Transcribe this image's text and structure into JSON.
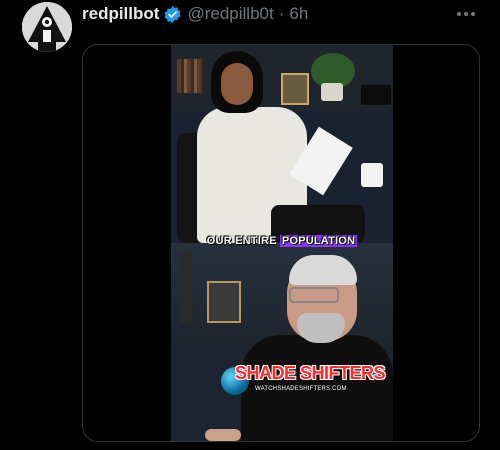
{
  "post": {
    "display_name": "redpillbot",
    "handle": "@redpillb0t",
    "separator": "·",
    "time": "6h",
    "verified": true
  },
  "icons": {
    "verified": "verified-badge-icon",
    "more": "more-horizontal-icon"
  },
  "colors": {
    "verified": "#1d9bf0",
    "muted": "#71767b",
    "caption_highlight": "#8e35ff",
    "logo_red": "#ff2b2b"
  },
  "media": {
    "caption_part1": "OUR ENTIRE ",
    "caption_part2": "POPULATION",
    "logo_title": "SHADE SHIFTERS",
    "logo_sub": "WATCHSHADESHIFTERS.COM"
  }
}
